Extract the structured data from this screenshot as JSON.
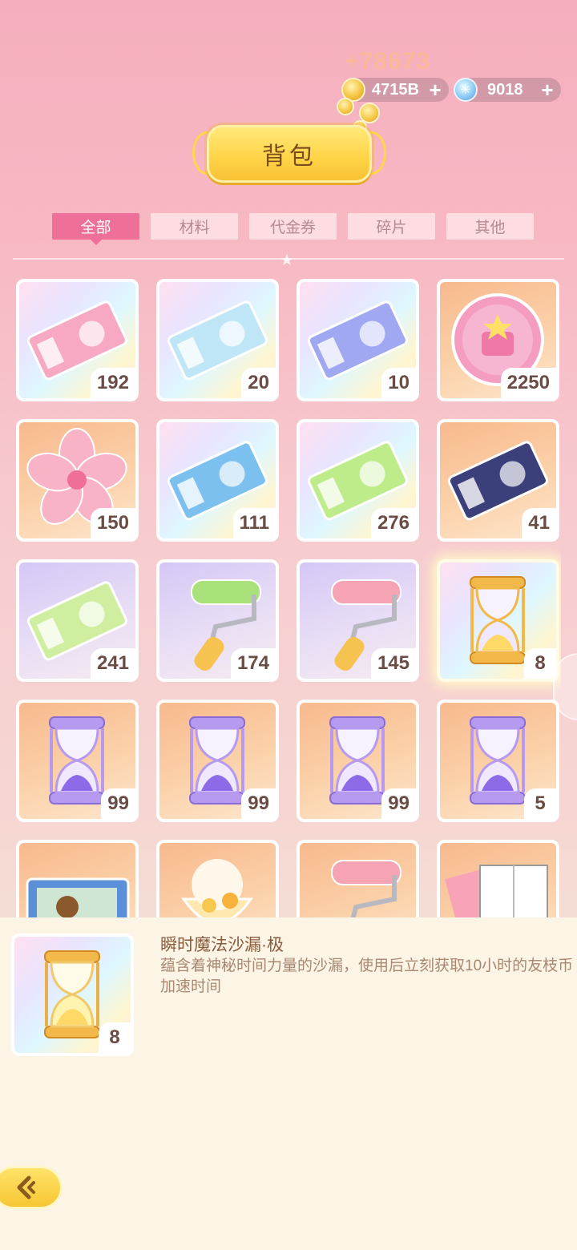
{
  "header": {
    "floating_score": "+78673",
    "gold": {
      "value": "4715B",
      "plus": "+"
    },
    "gem": {
      "value": "9018",
      "plus": "+"
    },
    "title": "背包"
  },
  "tabs": [
    {
      "label": "全部",
      "active": true
    },
    {
      "label": "材料",
      "active": false
    },
    {
      "label": "代金券",
      "active": false
    },
    {
      "label": "碎片",
      "active": false
    },
    {
      "label": "其他",
      "active": false
    }
  ],
  "items": [
    {
      "icon": "pink-ticket-icon",
      "count": "192",
      "bg": "rainbow"
    },
    {
      "icon": "rainbow-avatar-ticket-icon",
      "count": "20",
      "bg": "rainbow"
    },
    {
      "icon": "mystery-card-ticket-icon",
      "count": "10",
      "bg": "rainbow"
    },
    {
      "icon": "pink-bag-coin-icon",
      "count": "2250",
      "bg": "orange"
    },
    {
      "icon": "sakura-flower-icon",
      "count": "150",
      "bg": "orange"
    },
    {
      "icon": "blue-ticket-icon",
      "count": "111",
      "bg": "rainbow"
    },
    {
      "icon": "video-ticket-icon",
      "count": "276",
      "bg": "rainbow"
    },
    {
      "icon": "dark-bag-ticket-icon",
      "count": "41",
      "bg": "orange"
    },
    {
      "icon": "green-bag-ticket-icon",
      "count": "241",
      "bg": "purple"
    },
    {
      "icon": "green-paint-roller-icon",
      "count": "174",
      "bg": "purple"
    },
    {
      "icon": "pink-paint-roller-icon",
      "count": "145",
      "bg": "purple"
    },
    {
      "icon": "golden-hourglass-icon",
      "count": "8",
      "bg": "rainbow",
      "selected": true
    },
    {
      "icon": "purple-hourglass-icon",
      "count": "99",
      "bg": "orange"
    },
    {
      "icon": "purple-hourglass-icon",
      "count": "99",
      "bg": "orange"
    },
    {
      "icon": "purple-hourglass-icon",
      "count": "99",
      "bg": "orange"
    },
    {
      "icon": "purple-hourglass-icon",
      "count": "5",
      "bg": "orange"
    },
    {
      "icon": "puzzle-box-icon",
      "count": "",
      "bg": "orange"
    },
    {
      "icon": "ice-cream-sundae-icon",
      "count": "",
      "bg": "orange"
    },
    {
      "icon": "game-controller-icon",
      "count": "",
      "bg": "orange"
    },
    {
      "icon": "manga-book-icon",
      "count": "",
      "bg": "orange"
    }
  ],
  "detail": {
    "name": "瞬时魔法沙漏·极",
    "description": "蕴含着神秘时间力量的沙漏，使用后立刻获取10小时的友枝币加速时间",
    "count": "8",
    "icon": "golden-hourglass-icon"
  },
  "colors": {
    "tab_active": "#ee6f98",
    "title_gold": "#ffd54a",
    "panel_bg": "#fcf5e6"
  }
}
